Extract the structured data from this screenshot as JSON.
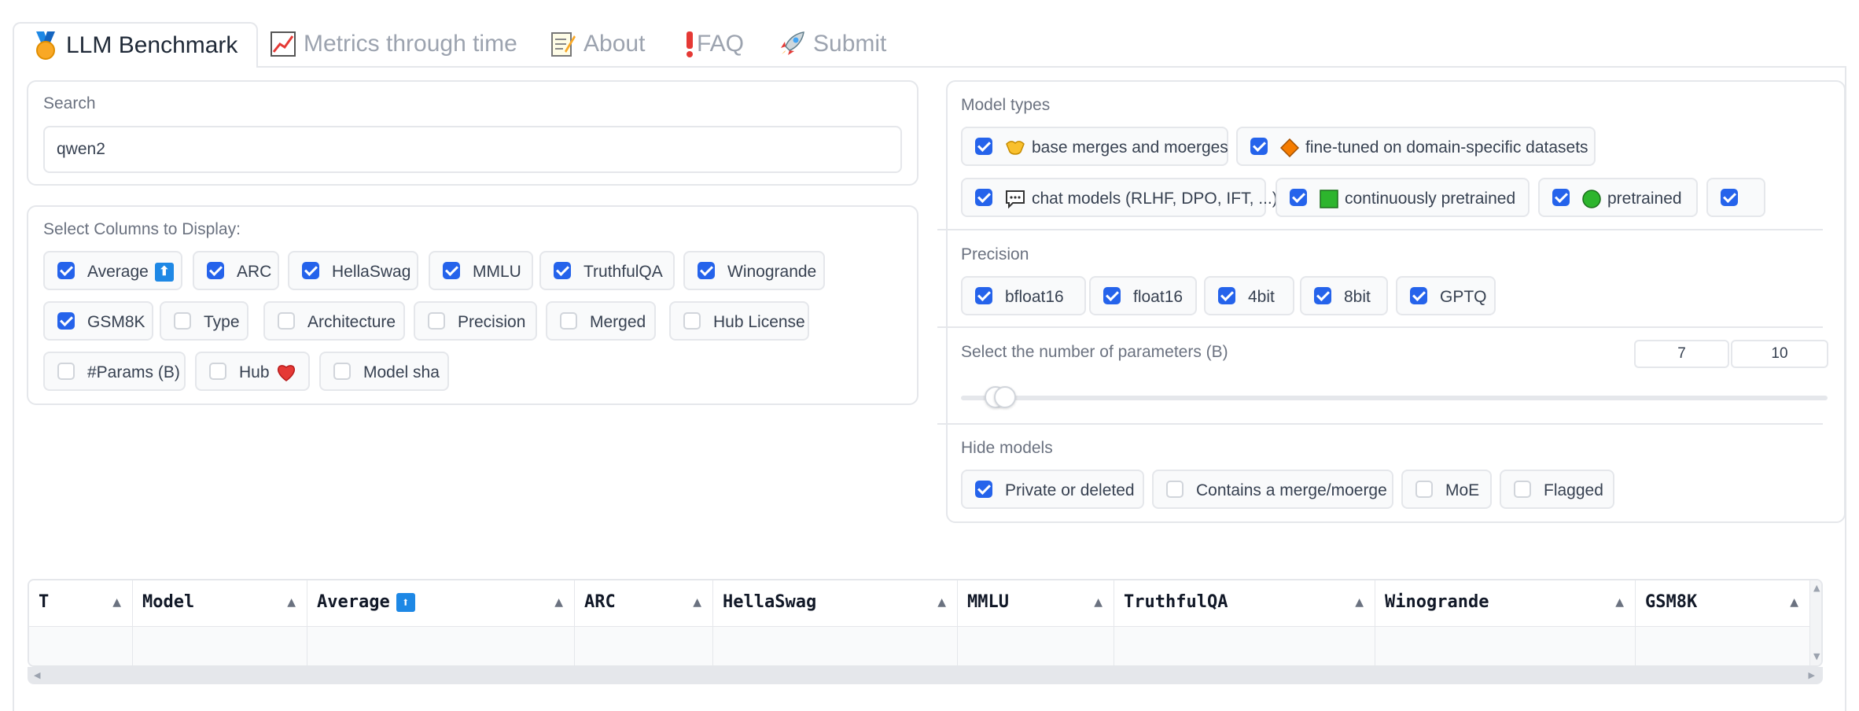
{
  "tabs": [
    {
      "label": "LLM Benchmark",
      "icon": "medal-icon"
    },
    {
      "label": "Metrics through time",
      "icon": "chart-increasing-icon"
    },
    {
      "label": "About",
      "icon": "memo-icon"
    },
    {
      "label": "FAQ",
      "icon": "exclamation-icon"
    },
    {
      "label": "Submit",
      "icon": "rocket-icon"
    }
  ],
  "search": {
    "label": "Search",
    "value": "qwen2"
  },
  "columns": {
    "label": "Select Columns to Display:",
    "items": [
      {
        "label": "Average",
        "checked": true
      },
      {
        "label": "ARC",
        "checked": true
      },
      {
        "label": "HellaSwag",
        "checked": true
      },
      {
        "label": "MMLU",
        "checked": true
      },
      {
        "label": "TruthfulQA",
        "checked": true
      },
      {
        "label": "Winogrande",
        "checked": true
      },
      {
        "label": "GSM8K",
        "checked": true
      },
      {
        "label": "Type",
        "checked": false
      },
      {
        "label": "Architecture",
        "checked": false
      },
      {
        "label": "Precision",
        "checked": false
      },
      {
        "label": "Merged",
        "checked": false
      },
      {
        "label": "Hub License",
        "checked": false
      },
      {
        "label": "#Params (B)",
        "checked": false
      },
      {
        "label": "Hub",
        "checked": false
      },
      {
        "label": "Model sha",
        "checked": false
      }
    ]
  },
  "model_types": {
    "label": "Model types",
    "items": [
      {
        "label": "base merges and moerges",
        "icon": "handshake-icon",
        "checked": true
      },
      {
        "label": "fine-tuned on domain-specific datasets",
        "icon": "orange-diamond-icon",
        "checked": true
      },
      {
        "label": "chat models (RLHF, DPO, IFT, ...)",
        "icon": "speech-balloon-icon",
        "checked": true
      },
      {
        "label": "continuously pretrained",
        "icon": "green-square-icon",
        "checked": true
      },
      {
        "label": "pretrained",
        "icon": "green-circle-icon",
        "checked": true
      },
      {
        "label": "",
        "icon": "",
        "checked": true
      }
    ]
  },
  "precision": {
    "label": "Precision",
    "items": [
      {
        "label": "bfloat16",
        "checked": true
      },
      {
        "label": "float16",
        "checked": true
      },
      {
        "label": "4bit",
        "checked": true
      },
      {
        "label": "8bit",
        "checked": true
      },
      {
        "label": "GPTQ",
        "checked": true
      }
    ]
  },
  "params": {
    "label": "Select the number of parameters (B)",
    "min_value": "7",
    "max_value": "10"
  },
  "hide_models": {
    "label": "Hide models",
    "items": [
      {
        "label": "Private or deleted",
        "checked": true
      },
      {
        "label": "Contains a merge/moerge",
        "checked": false
      },
      {
        "label": "MoE",
        "checked": false
      },
      {
        "label": "Flagged",
        "checked": false
      }
    ]
  },
  "table": {
    "headers": [
      "T",
      "Model",
      "Average",
      "ARC",
      "HellaSwag",
      "MMLU",
      "TruthfulQA",
      "Winogrande",
      "GSM8K"
    ],
    "sort_icon": "▲"
  },
  "colors": {
    "accent": "#2563eb",
    "border": "#e5e7eb",
    "muted": "#6b7280"
  }
}
